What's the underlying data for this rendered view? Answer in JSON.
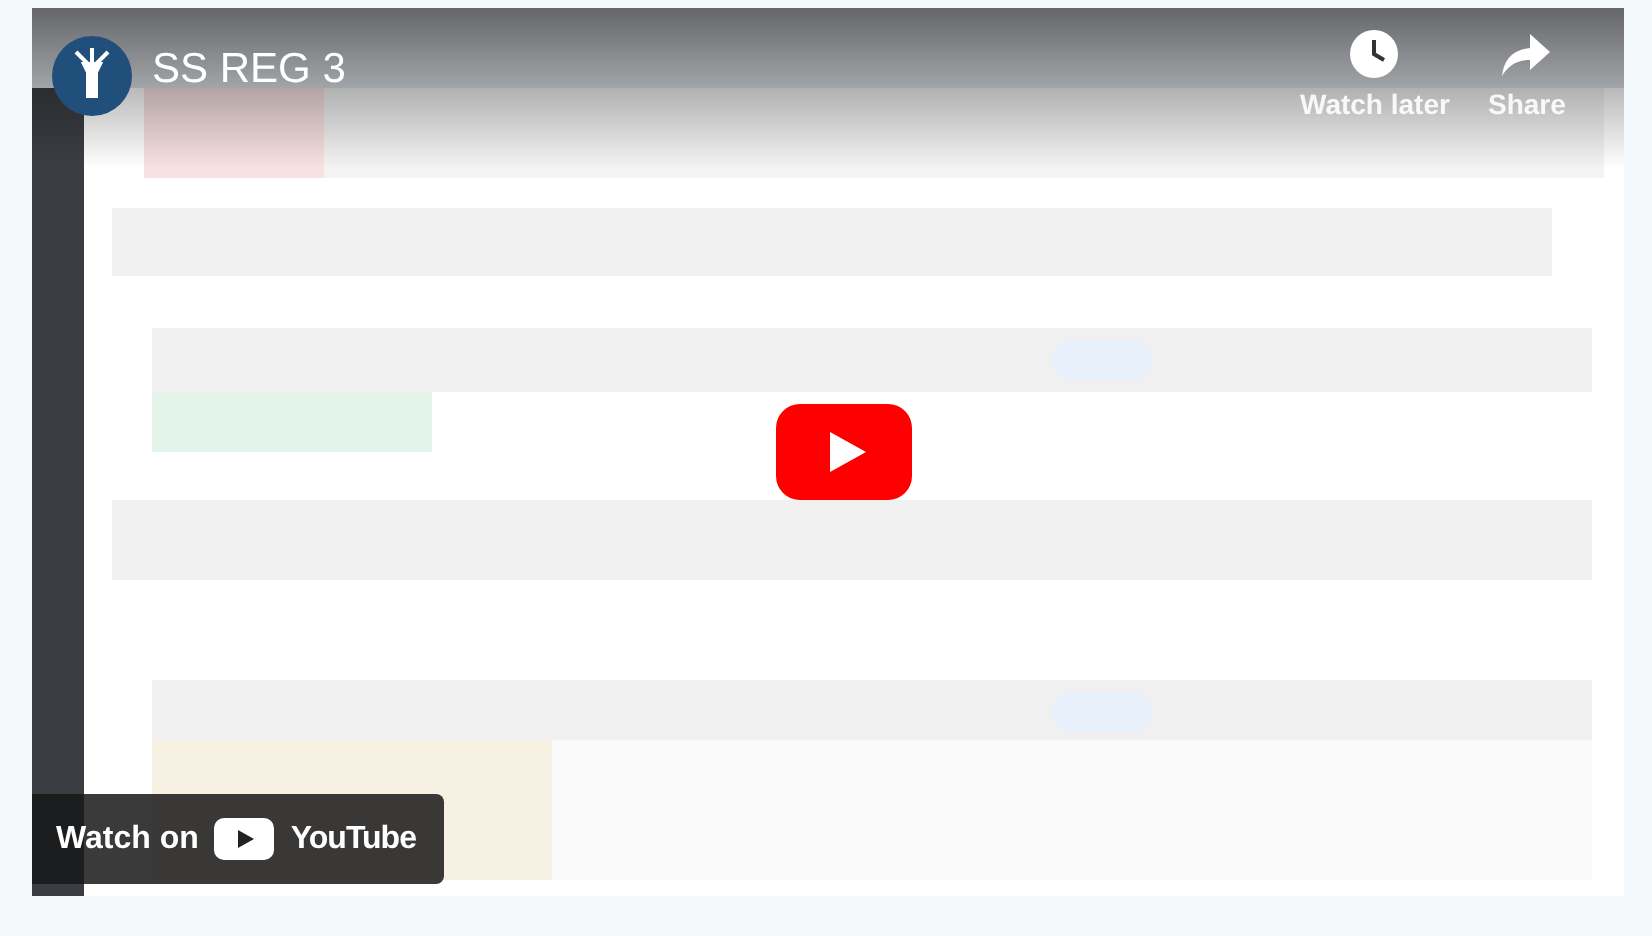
{
  "video": {
    "kind": "picture",
    "title": "SS REG 3",
    "actions": [
      {
        "kind": "clock",
        "label": "Watch later"
      },
      {
        "kind": "share",
        "label": "Share"
      }
    ],
    "watch_on": {
      "label": "Watch on",
      "brand": "YouTube"
    }
  }
}
